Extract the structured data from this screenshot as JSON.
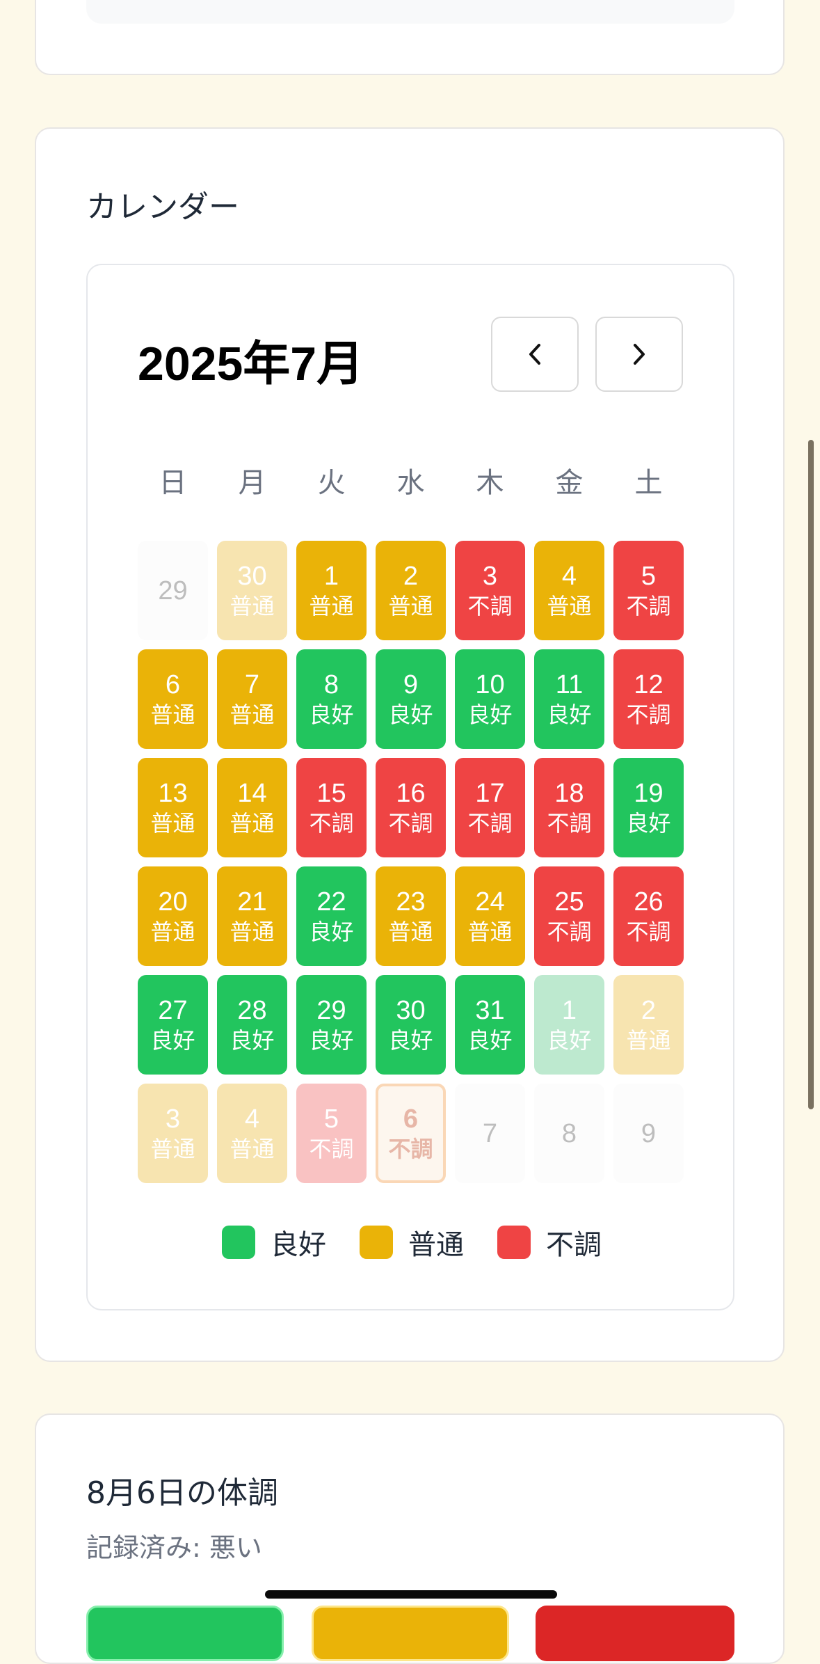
{
  "calendar_section": {
    "title": "カレンダー",
    "month_title": "2025年7月",
    "prev_label": "‹",
    "next_label": "›",
    "weekdays": [
      "日",
      "月",
      "火",
      "水",
      "木",
      "金",
      "土"
    ],
    "days": [
      {
        "n": "29",
        "s": "",
        "t": "empty"
      },
      {
        "n": "30",
        "s": "普通",
        "t": "normal",
        "faded": true
      },
      {
        "n": "1",
        "s": "普通",
        "t": "normal"
      },
      {
        "n": "2",
        "s": "普通",
        "t": "normal"
      },
      {
        "n": "3",
        "s": "不調",
        "t": "bad"
      },
      {
        "n": "4",
        "s": "普通",
        "t": "normal"
      },
      {
        "n": "5",
        "s": "不調",
        "t": "bad"
      },
      {
        "n": "6",
        "s": "普通",
        "t": "normal"
      },
      {
        "n": "7",
        "s": "普通",
        "t": "normal"
      },
      {
        "n": "8",
        "s": "良好",
        "t": "good"
      },
      {
        "n": "9",
        "s": "良好",
        "t": "good"
      },
      {
        "n": "10",
        "s": "良好",
        "t": "good"
      },
      {
        "n": "11",
        "s": "良好",
        "t": "good"
      },
      {
        "n": "12",
        "s": "不調",
        "t": "bad"
      },
      {
        "n": "13",
        "s": "普通",
        "t": "normal"
      },
      {
        "n": "14",
        "s": "普通",
        "t": "normal"
      },
      {
        "n": "15",
        "s": "不調",
        "t": "bad"
      },
      {
        "n": "16",
        "s": "不調",
        "t": "bad"
      },
      {
        "n": "17",
        "s": "不調",
        "t": "bad"
      },
      {
        "n": "18",
        "s": "不調",
        "t": "bad"
      },
      {
        "n": "19",
        "s": "良好",
        "t": "good"
      },
      {
        "n": "20",
        "s": "普通",
        "t": "normal"
      },
      {
        "n": "21",
        "s": "普通",
        "t": "normal"
      },
      {
        "n": "22",
        "s": "良好",
        "t": "good"
      },
      {
        "n": "23",
        "s": "普通",
        "t": "normal"
      },
      {
        "n": "24",
        "s": "普通",
        "t": "normal"
      },
      {
        "n": "25",
        "s": "不調",
        "t": "bad"
      },
      {
        "n": "26",
        "s": "不調",
        "t": "bad"
      },
      {
        "n": "27",
        "s": "良好",
        "t": "good"
      },
      {
        "n": "28",
        "s": "良好",
        "t": "good"
      },
      {
        "n": "29",
        "s": "良好",
        "t": "good"
      },
      {
        "n": "30",
        "s": "良好",
        "t": "good"
      },
      {
        "n": "31",
        "s": "良好",
        "t": "good"
      },
      {
        "n": "1",
        "s": "良好",
        "t": "good",
        "faded": true
      },
      {
        "n": "2",
        "s": "普通",
        "t": "normal",
        "faded": true
      },
      {
        "n": "3",
        "s": "普通",
        "t": "normal",
        "faded": true
      },
      {
        "n": "4",
        "s": "普通",
        "t": "normal",
        "faded": true
      },
      {
        "n": "5",
        "s": "不調",
        "t": "bad",
        "faded": true
      },
      {
        "n": "6",
        "s": "不調",
        "t": "today"
      },
      {
        "n": "7",
        "s": "",
        "t": "empty"
      },
      {
        "n": "8",
        "s": "",
        "t": "empty"
      },
      {
        "n": "9",
        "s": "",
        "t": "empty"
      }
    ],
    "legend": [
      {
        "label": "良好",
        "color": "#22c55e"
      },
      {
        "label": "普通",
        "color": "#eab308"
      },
      {
        "label": "不調",
        "color": "#ef4444"
      }
    ]
  },
  "record_section": {
    "title": "8月6日の体調",
    "status": "記録済み: 悪い"
  },
  "colors": {
    "good": "#22c55e",
    "normal": "#eab308",
    "bad": "#ef4444",
    "background": "#fdf9e9"
  }
}
